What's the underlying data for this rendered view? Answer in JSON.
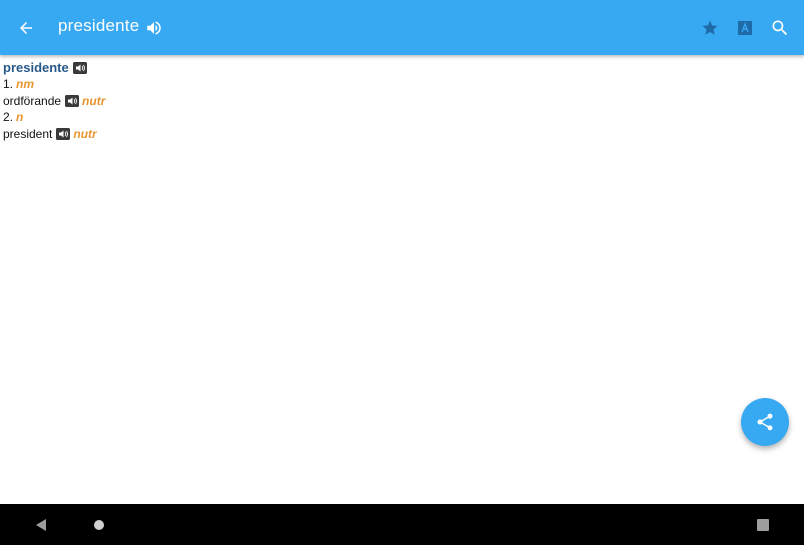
{
  "appbar": {
    "title": "presidente",
    "back_icon": "arrow-left-icon",
    "speak_icon": "volume-icon",
    "star_icon": "star-icon",
    "translate_icon": "translate-icon",
    "search_icon": "search-icon",
    "background_color": "#37a8f2"
  },
  "entry": {
    "headword": "presidente",
    "senses": [
      {
        "number": "1.",
        "pos": "nm",
        "translation": "ordförande",
        "gender": "nutr"
      },
      {
        "number": "2.",
        "pos": "n",
        "translation": "president",
        "gender": "nutr"
      }
    ]
  },
  "fab": {
    "icon": "share-icon"
  },
  "navbar": {
    "back_icon": "nav-back-icon",
    "home_icon": "nav-home-icon",
    "recent_icon": "nav-recent-icon"
  },
  "colors": {
    "headword": "#2a5a8a",
    "pos": "#e8952f"
  }
}
